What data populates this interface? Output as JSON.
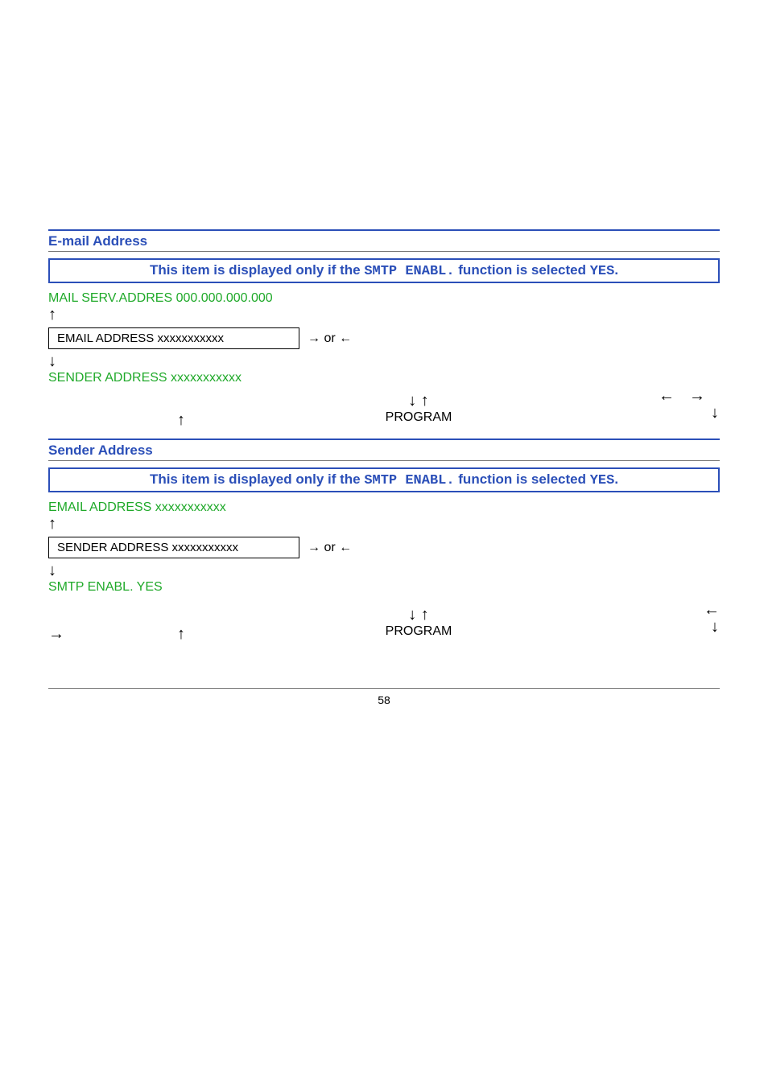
{
  "sections": {
    "email": {
      "title": "E-mail Address",
      "banner_pre": "This item is displayed only if the ",
      "banner_mono1": "SMTP  ENABL.",
      "banner_mid": " function is selected ",
      "banner_mono2": "YES",
      "banner_post": ".",
      "prev": "MAIL SERV.ADDRES 000.000.000.000",
      "field": "EMAIL  ADDRESS   xxxxxxxxxxx",
      "or_left": "→",
      "or_text": " or ",
      "or_right": "←",
      "next": "SENDER ADDRESS xxxxxxxxxxx",
      "up_arrow_s": "↑",
      "down_arrow_s": "↓",
      "nav_up": "↑",
      "nav_ud": "↓      ↑",
      "nav_label": "PROGRAM",
      "nav_lr": "←→",
      "nav_down_r": "↓"
    },
    "sender": {
      "title": "Sender Address",
      "banner_pre": "This item is displayed only if the ",
      "banner_mono1": "SMTP  ENABL.",
      "banner_mid": " function is selected ",
      "banner_mono2": "YES",
      "banner_post": ".",
      "prev": "EMAIL  ADDRESS   xxxxxxxxxxx",
      "field": "SENDER ADDRESS   xxxxxxxxxxx",
      "or_left": "→",
      "or_text": " or ",
      "or_right": "←",
      "next": "SMTP ENABL. YES",
      "small_left": "→",
      "up_arrow_s": "↑",
      "down_arrow_s": "↓",
      "nav_up": "↑",
      "nav_ud": "↓      ↑",
      "nav_label": "PROGRAM",
      "nav_left_only": "←",
      "nav_down_r": "↓"
    }
  },
  "page_number": "58"
}
